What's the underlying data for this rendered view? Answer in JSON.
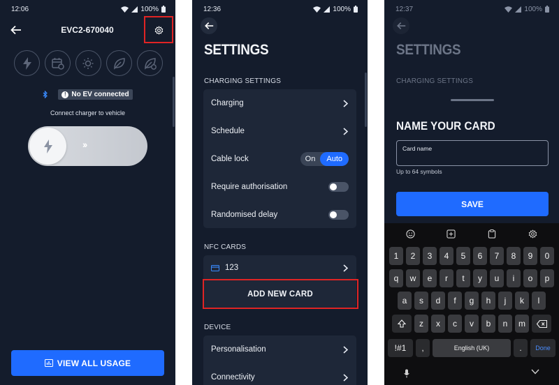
{
  "colors": {
    "background": "#141c2c",
    "card": "#1e2738",
    "accent": "#1f6bff",
    "highlight": "#e02424"
  },
  "screen1": {
    "time": "12:06",
    "battery": "100%",
    "device_id": "EVC2-670040",
    "modes": [
      "bolt-icon",
      "calendar-clock-icon",
      "sun-gear-icon",
      "leaf-icon",
      "leaf-off-icon"
    ],
    "ev_status": "No EV connected",
    "instruction": "Connect charger to vehicle",
    "slider_arrows": "››",
    "usage_button": "VIEW ALL USAGE"
  },
  "screen2": {
    "time": "12:36",
    "battery": "100%",
    "title": "SETTINGS",
    "charging_section": "CHARGING SETTINGS",
    "charging_rows": [
      {
        "label": "Charging",
        "control": "chevron"
      },
      {
        "label": "Schedule",
        "control": "chevron"
      },
      {
        "label": "Cable lock",
        "control": "segmented"
      },
      {
        "label": "Require authorisation",
        "control": "toggle"
      },
      {
        "label": "Randomised delay",
        "control": "toggle"
      }
    ],
    "cable_lock": {
      "on": "On",
      "auto": "Auto",
      "selected": "Auto"
    },
    "require_authorisation": false,
    "randomised_delay": false,
    "nfc_section": "NFC CARDS",
    "nfc_card": "123",
    "add_card": "ADD NEW CARD",
    "device_section": "DEVICE",
    "device_rows": [
      "Personalisation",
      "Connectivity"
    ]
  },
  "screen3": {
    "time": "12:37",
    "battery": "100%",
    "bg_title": "SETTINGS",
    "bg_section": "CHARGING SETTINGS",
    "sheet_title": "NAME YOUR CARD",
    "field_label": "Card name",
    "field_value": "",
    "hint": "Up to 64 symbols",
    "save": "SAVE",
    "keyboard": {
      "numbers": [
        "1",
        "2",
        "3",
        "4",
        "5",
        "6",
        "7",
        "8",
        "9",
        "0"
      ],
      "row1": [
        "q",
        "w",
        "e",
        "r",
        "t",
        "y",
        "u",
        "i",
        "o",
        "p"
      ],
      "row2": [
        "a",
        "s",
        "d",
        "f",
        "g",
        "h",
        "j",
        "k",
        "l"
      ],
      "row3": [
        "z",
        "x",
        "c",
        "v",
        "b",
        "n",
        "m"
      ],
      "symbols": "!#1",
      "comma": ",",
      "space": "English (UK)",
      "period": ".",
      "done": "Done"
    }
  }
}
